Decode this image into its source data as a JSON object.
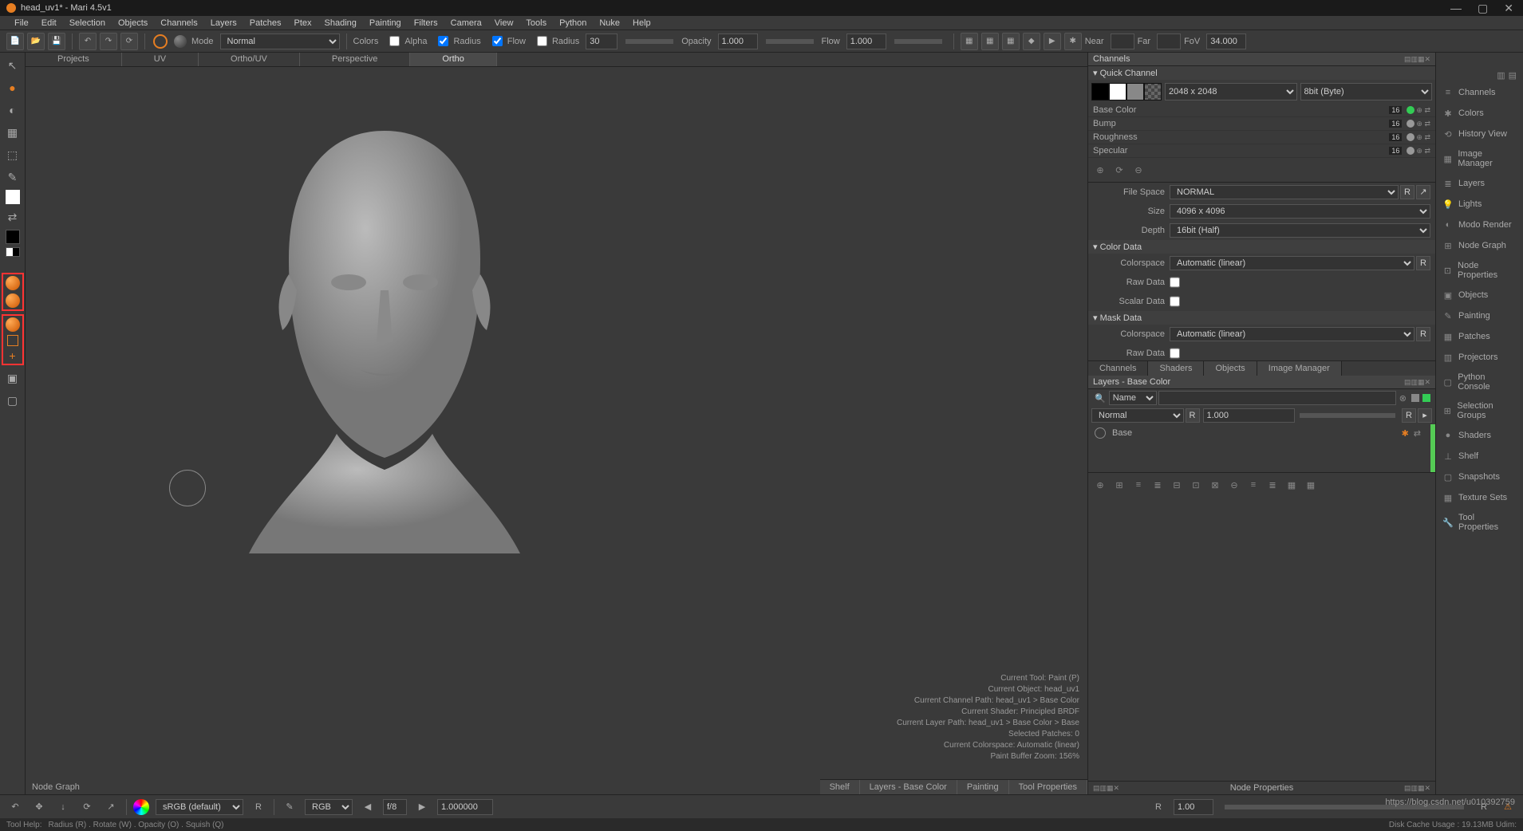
{
  "title": "head_uv1* - Mari 4.5v1",
  "menubar": [
    "File",
    "Edit",
    "Selection",
    "Objects",
    "Channels",
    "Layers",
    "Patches",
    "Ptex",
    "Shading",
    "Painting",
    "Filters",
    "Camera",
    "View",
    "Tools",
    "Python",
    "Nuke",
    "Help"
  ],
  "toolbar": {
    "mode_label": "Mode",
    "mode_value": "Normal",
    "colors_label": "Colors",
    "alpha_label": "Alpha",
    "radius_label": "Radius",
    "flow_label": "Flow",
    "radius2_label": "Radius",
    "radius2_value": "30",
    "opacity_label": "Opacity",
    "opacity_value": "1.000",
    "flow2_label": "Flow",
    "flow2_value": "1.000",
    "near_label": "Near",
    "far_label": "Far",
    "fov_label": "FoV",
    "fov_value": "34.000"
  },
  "view_tabs": [
    "Projects",
    "UV",
    "Ortho/UV",
    "Perspective",
    "Ortho"
  ],
  "view_tabs_active": 4,
  "viewport_info": {
    "l1": "Current Tool: Paint (P)",
    "l2": "Current Object: head_uv1",
    "l3": "Current Channel Path: head_uv1 > Base Color",
    "l4": "Current Shader: Principled BRDF",
    "l5": "Current Layer Path: head_uv1 > Base Color > Base",
    "l6": "Selected Patches: 0",
    "l7": "Current Colorspace: Automatic (linear)",
    "l8": "Paint Buffer Zoom: 156%"
  },
  "view_bottom_tabs": [
    "Shelf",
    "Layers - Base Color",
    "Painting",
    "Tool Properties"
  ],
  "node_graph_label": "Node Graph",
  "channels": {
    "header": "Channels",
    "quick_channel": "Quick Channel",
    "res_value": "2048 x 2048",
    "depth_value": "8bit (Byte)",
    "rows": [
      {
        "name": "Base Color",
        "bits": "16"
      },
      {
        "name": "Bump",
        "bits": "16"
      },
      {
        "name": "Roughness",
        "bits": "16"
      },
      {
        "name": "Specular",
        "bits": "16"
      }
    ],
    "file_space_label": "File Space",
    "file_space_value": "NORMAL",
    "size_label": "Size",
    "size_value": "4096 x 4096",
    "depth_label2": "Depth",
    "depth_value2": "16bit (Half)",
    "color_data": "Color Data",
    "colorspace_label": "Colorspace",
    "colorspace_value": "Automatic (linear)",
    "raw_data": "Raw Data",
    "scalar_data": "Scalar Data",
    "mask_data": "Mask Data",
    "raw_data2": "Raw Data"
  },
  "mid_tabs": [
    "Channels",
    "Shaders",
    "Objects",
    "Image Manager"
  ],
  "layers": {
    "header": "Layers - Base Color",
    "search_placeholder": "Name",
    "blend_mode": "Normal",
    "opacity": "1.000",
    "layer_name": "Base"
  },
  "np_label": "Node Properties",
  "far_right": [
    "Channels",
    "Colors",
    "History View",
    "Image Manager",
    "Layers",
    "Lights",
    "Modo Render",
    "Node Graph",
    "Node Properties",
    "Objects",
    "Painting",
    "Patches",
    "Projectors",
    "Python Console",
    "Selection Groups",
    "Shaders",
    "Shelf",
    "Snapshots",
    "Texture Sets",
    "Tool Properties"
  ],
  "statusbar": {
    "colorspace": "sRGB (default)",
    "rgb_label": "RGB",
    "fstop": "f/8",
    "fstop_val": "1.000000",
    "r_val": "1.00"
  },
  "statusbar2": {
    "tool_help": "Tool Help:",
    "help_text": "Radius (R) . Rotate (W) . Opacity (O) . Squish (Q)",
    "disk": "Disk Cache Usage : 19.13MB  Udim:"
  },
  "watermark": "https://blog.csdn.net/u010392759"
}
